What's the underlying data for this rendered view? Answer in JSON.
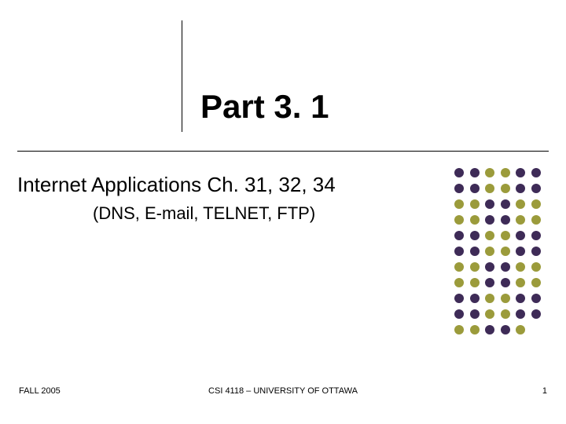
{
  "title": "Part 3. 1",
  "body": {
    "line1": "Internet Applications Ch. 31, 32, 34",
    "line2": "(DNS, E-mail, TELNET, FTP)"
  },
  "footer": {
    "left": "FALL 2005",
    "center": "CSI 4118 – UNIVERSITY OF OTTAWA",
    "right": "1"
  },
  "decor": {
    "colors": {
      "purple": "#3e2b57",
      "olive": "#9b9b3b"
    },
    "grid": [
      [
        "purple",
        "purple",
        "olive",
        "olive",
        "purple",
        "purple"
      ],
      [
        "purple",
        "purple",
        "olive",
        "olive",
        "purple",
        "purple"
      ],
      [
        "olive",
        "olive",
        "purple",
        "purple",
        "olive",
        "olive"
      ],
      [
        "olive",
        "olive",
        "purple",
        "purple",
        "olive",
        "olive"
      ],
      [
        "purple",
        "purple",
        "olive",
        "olive",
        "purple",
        "purple"
      ],
      [
        "purple",
        "purple",
        "olive",
        "olive",
        "purple",
        "purple"
      ],
      [
        "olive",
        "olive",
        "purple",
        "purple",
        "olive",
        "olive"
      ],
      [
        "olive",
        "olive",
        "purple",
        "purple",
        "olive",
        "olive"
      ],
      [
        "purple",
        "purple",
        "olive",
        "olive",
        "purple",
        "purple"
      ],
      [
        "purple",
        "purple",
        "olive",
        "olive",
        "purple",
        "purple"
      ],
      [
        "olive",
        "olive",
        "purple",
        "purple",
        "olive",
        "skip"
      ]
    ]
  }
}
